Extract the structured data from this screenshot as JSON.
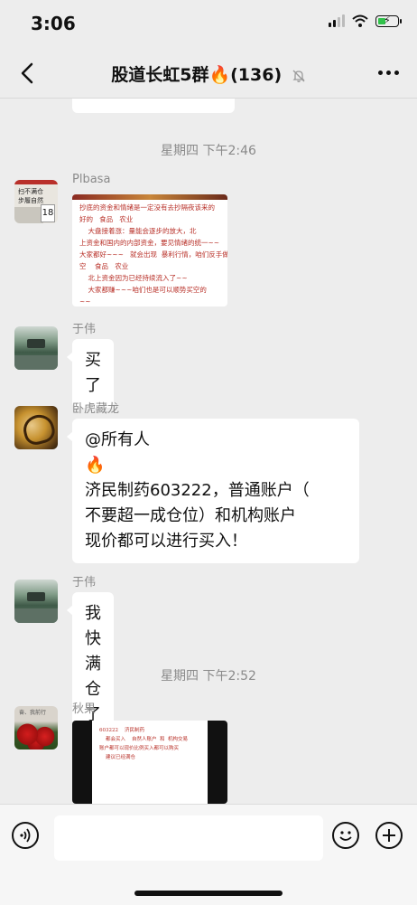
{
  "status_bar": {
    "time": "3:06"
  },
  "header": {
    "title": "股道长虹5群🔥(136)"
  },
  "chat": {
    "dividers": [
      "星期四 下午2:46",
      "星期四 下午2:52"
    ],
    "messages": [
      {
        "sender": "Plbasa",
        "type": "image",
        "avatar_text": [
          "扫不满仓",
          "步履自然"
        ],
        "avatar_number": "18",
        "image_lines": [
          "抄底的资金和情绪是一定没有去抄隔夜该来的",
          "好的   食品   农业",
          "    大盘接着涨：量能会逐步的放大，北",
          "上资金和国内的内部资金，要见情绪的统一~~",
          "大家都好~~~   就会出现  暴利行情，咱们反手做",
          "空    食品   农业",
          "    北上资金因为已经持续流入了~~",
          "    大家都赚~~~咱们也是可以顺势买空的",
          "~~"
        ]
      },
      {
        "sender": "于伟",
        "type": "text",
        "text": "买了"
      },
      {
        "sender": "卧虎藏龙",
        "type": "text",
        "lines": [
          "@所有人",
          "🔥",
          "济民制药603222，普通账户（",
          "不要超一成仓位）和机构账户",
          "现价都可以进行买入！"
        ]
      },
      {
        "sender": "于伟",
        "type": "text",
        "text": "我快满仓了"
      },
      {
        "sender": "秋果",
        "type": "image",
        "avatar_text": "奋、我前行",
        "image_lines": [
          "603222    济民制药",
          "    都会买入    自然人账户  和  机构交易",
          "账户都可以现价比例买入都可以购买",
          "    建议已经满仓"
        ]
      }
    ]
  },
  "colors": {
    "background": "#ededed",
    "bubble": "#ffffff",
    "doc_text": "#b83028",
    "battery": "#30c24a"
  },
  "icons": {
    "back": "chevron-left-icon",
    "mute": "bell-off-icon",
    "more": "more-dots-icon",
    "voice": "voice-icon",
    "emoji": "emoji-icon",
    "plus": "plus-icon"
  }
}
